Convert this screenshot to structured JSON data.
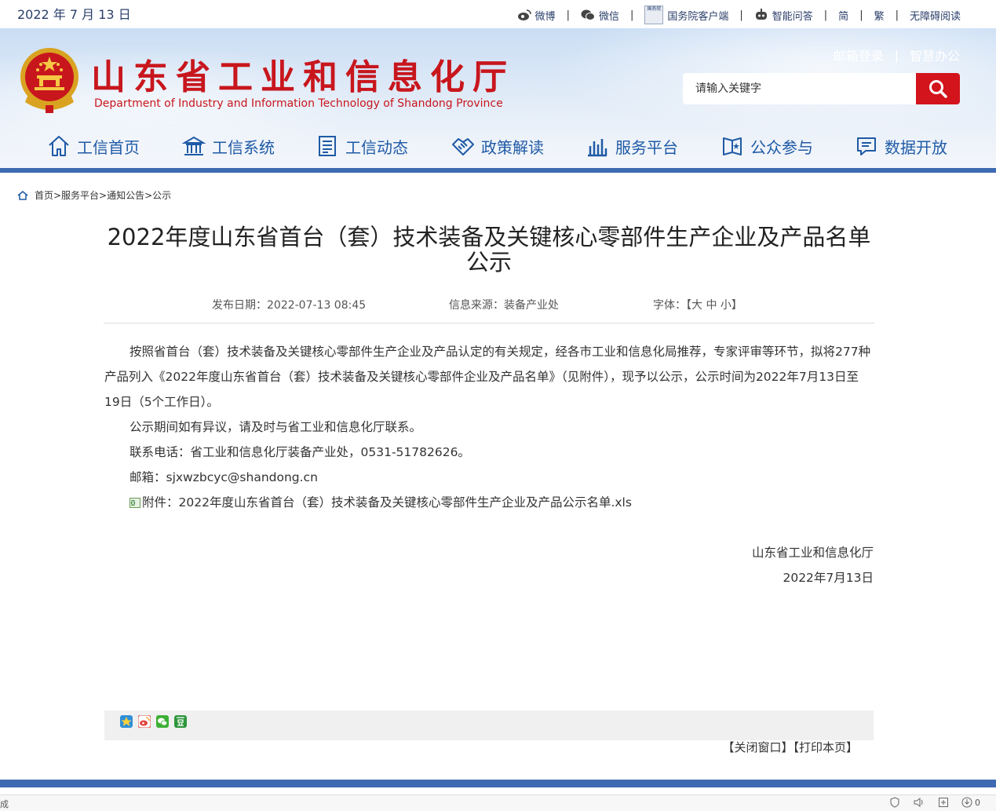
{
  "topbar": {
    "date": "2022 年 7 月 13 日",
    "links": {
      "weibo": "微博",
      "wechat": "微信",
      "gov_client_icon": "国务院",
      "gov_client": "国务院客户端",
      "qa": "智能问答",
      "simplified": "简",
      "traditional": "繁",
      "accessible": "无障碍阅读"
    },
    "sep": "|"
  },
  "header": {
    "title": "山东省工业和信息化厅",
    "subtitle": "Department of Industry and Information Technology of Shandong Province",
    "mail_login": "邮箱登录",
    "smart_office": "智慧办公",
    "sep": "|",
    "search_placeholder": "请输入关键字",
    "accent": "#d3141c"
  },
  "nav": {
    "home": "工信首页",
    "system": "工信系统",
    "news": "工信动态",
    "policy": "政策解读",
    "service": "服务平台",
    "public": "公众参与",
    "data": "数据开放"
  },
  "breadcrumb": "首页>服务平台>通知公告>公示",
  "article": {
    "title": "2022年度山东省首台（套）技术装备及关键核心零部件生产企业及产品名单公示",
    "publish_date": "发布日期：2022-07-13 08:45",
    "source": "信息来源：装备产业处",
    "font_size_label": "字体：【大 中 小】",
    "paragraphs": [
      "按照省首台（套）技术装备及关键核心零部件生产企业及产品认定的有关规定，经各市工业和信息化局推荐，专家评审等环节，拟将277种产品列入《2022年度山东省首台（套）技术装备及关键核心零部件企业及产品名单》（见附件），现予以公示，公示时间为2022年7月13日至19日（5个工作日）。",
      "公示期间如有异议，请及时与省工业和信息化厅联系。",
      "联系电话：省工业和信息化厅装备产业处，0531-51782626。",
      "邮箱：sjxwzbcyc@shandong.cn"
    ],
    "attachment": "附件：2022年度山东省首台（套）技术装备及关键核心零部件生产企业及产品公示名单.xls",
    "signature": "山东省工业和信息化厅",
    "sign_date": "2022年7月13日"
  },
  "footer_actions": {
    "close": "【关闭窗口】",
    "print": "【打印本页】"
  },
  "status_bar": {
    "left": "成",
    "count": "0"
  },
  "colors": {
    "nav_blue": "#1f5aa6",
    "bar_blue": "#3e6ab2",
    "title_red": "#c8161d"
  }
}
